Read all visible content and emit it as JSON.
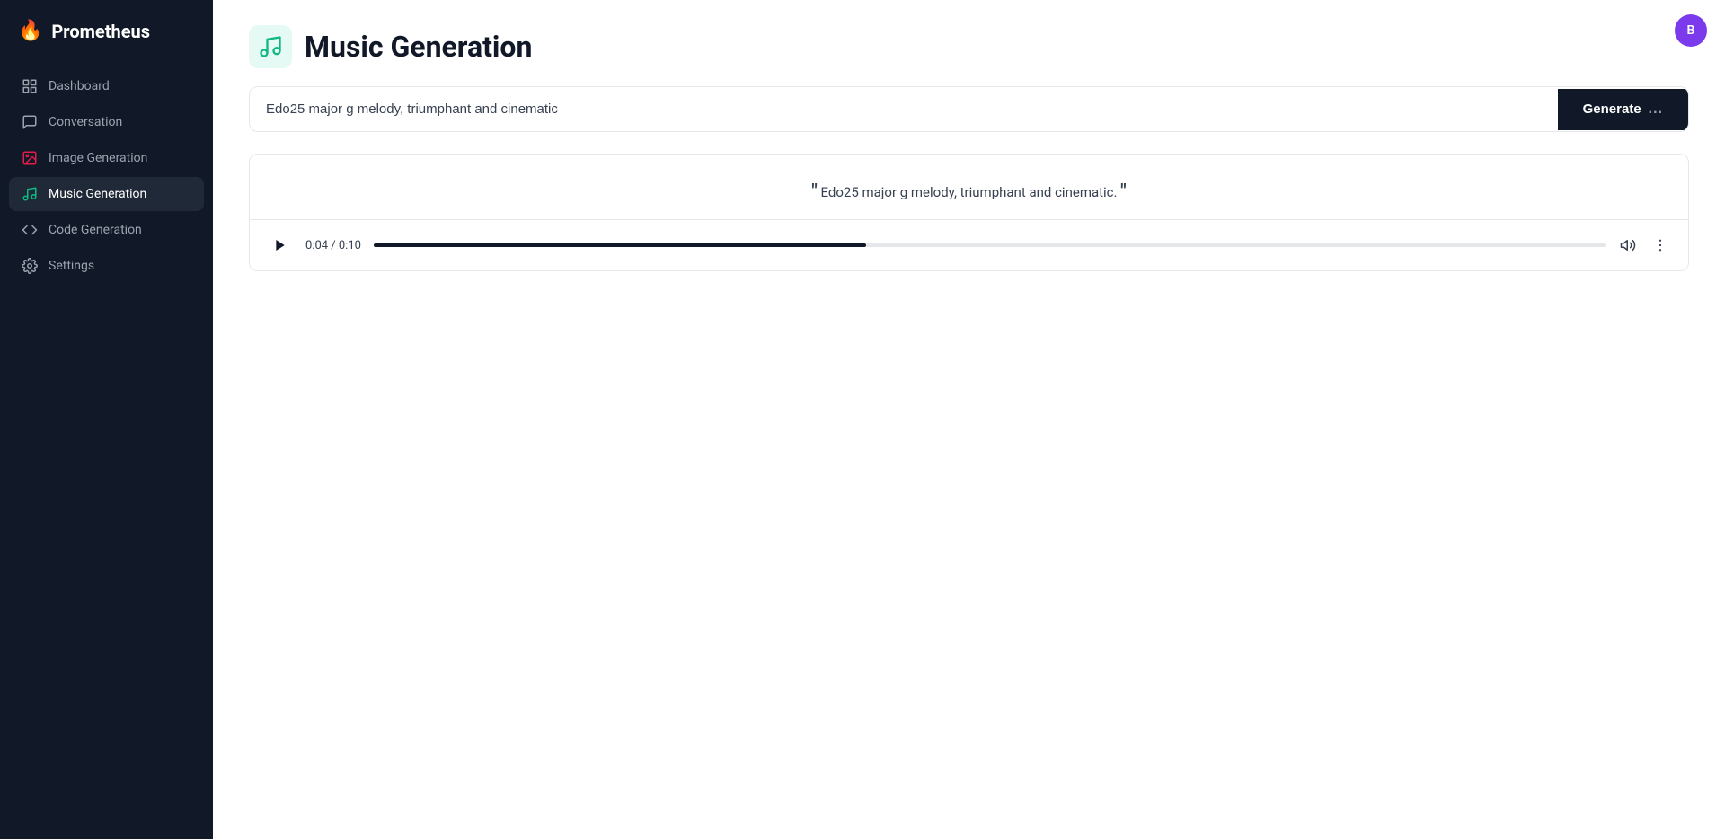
{
  "app": {
    "name": "Prometheus",
    "flame_icon": "🔥"
  },
  "sidebar": {
    "items": [
      {
        "id": "dashboard",
        "label": "Dashboard",
        "icon": "grid"
      },
      {
        "id": "conversation",
        "label": "Conversation",
        "icon": "chat"
      },
      {
        "id": "image-generation",
        "label": "Image Generation",
        "icon": "image"
      },
      {
        "id": "music-generation",
        "label": "Music Generation",
        "icon": "music",
        "active": true
      },
      {
        "id": "code-generation",
        "label": "Code Generation",
        "icon": "code"
      },
      {
        "id": "settings",
        "label": "Settings",
        "icon": "gear"
      }
    ]
  },
  "page": {
    "title": "Music Generation"
  },
  "user": {
    "avatar_letter": "B"
  },
  "prompt": {
    "placeholder": "Edo25 major g melody, triumphant and cinematic",
    "value": "Edo25 major g melody, triumphant and cinematic"
  },
  "generate_button": {
    "label": "Generate",
    "dots": "..."
  },
  "result": {
    "quote": "Edo25 major g melody, triumphant and cinematic."
  },
  "player": {
    "current_time": "0:04",
    "total_time": "0:10",
    "time_display": "0:04 / 0:10",
    "progress_percent": 40
  }
}
